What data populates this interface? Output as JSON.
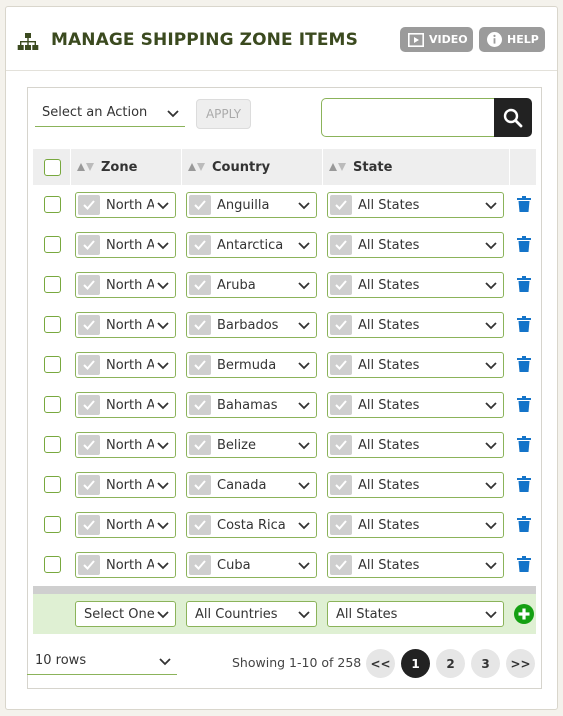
{
  "header": {
    "title": "MANAGE SHIPPING ZONE ITEMS",
    "video_label": "VIDEO",
    "help_label": "HELP"
  },
  "toolbar": {
    "action_select": "Select an Action",
    "apply_label": "APPLY",
    "search_value": ""
  },
  "columns": [
    "Zone",
    "Country",
    "State"
  ],
  "rows": [
    {
      "zone": "North A",
      "country": "Anguilla",
      "state": "All States"
    },
    {
      "zone": "North A",
      "country": "Antarctica",
      "state": "All States"
    },
    {
      "zone": "North A",
      "country": "Aruba",
      "state": "All States"
    },
    {
      "zone": "North A",
      "country": "Barbados",
      "state": "All States"
    },
    {
      "zone": "North A",
      "country": "Bermuda",
      "state": "All States"
    },
    {
      "zone": "North A",
      "country": "Bahamas",
      "state": "All States"
    },
    {
      "zone": "North A",
      "country": "Belize",
      "state": "All States"
    },
    {
      "zone": "North A",
      "country": "Canada",
      "state": "All States"
    },
    {
      "zone": "North A",
      "country": "Costa Rica",
      "state": "All States"
    },
    {
      "zone": "North A",
      "country": "Cuba",
      "state": "All States"
    }
  ],
  "add_row": {
    "zone": "Select One",
    "country": "All Countries",
    "state": "All States"
  },
  "footer": {
    "rows_per_page": "10 rows",
    "showing": "Showing 1-10 of 258",
    "prev": "<<",
    "pages": [
      "1",
      "2",
      "3"
    ],
    "next": ">>",
    "active_page": "1"
  },
  "colors": {
    "accent_green": "#78a83e",
    "title_green": "#3b4a1f",
    "trash_blue": "#1474c9",
    "add_green": "#14a012"
  },
  "icons": {
    "title": "sitemap-icon",
    "video": "play-icon",
    "help": "info-icon",
    "search": "search-icon",
    "delete": "trash-icon",
    "add": "plus-circle-icon"
  }
}
